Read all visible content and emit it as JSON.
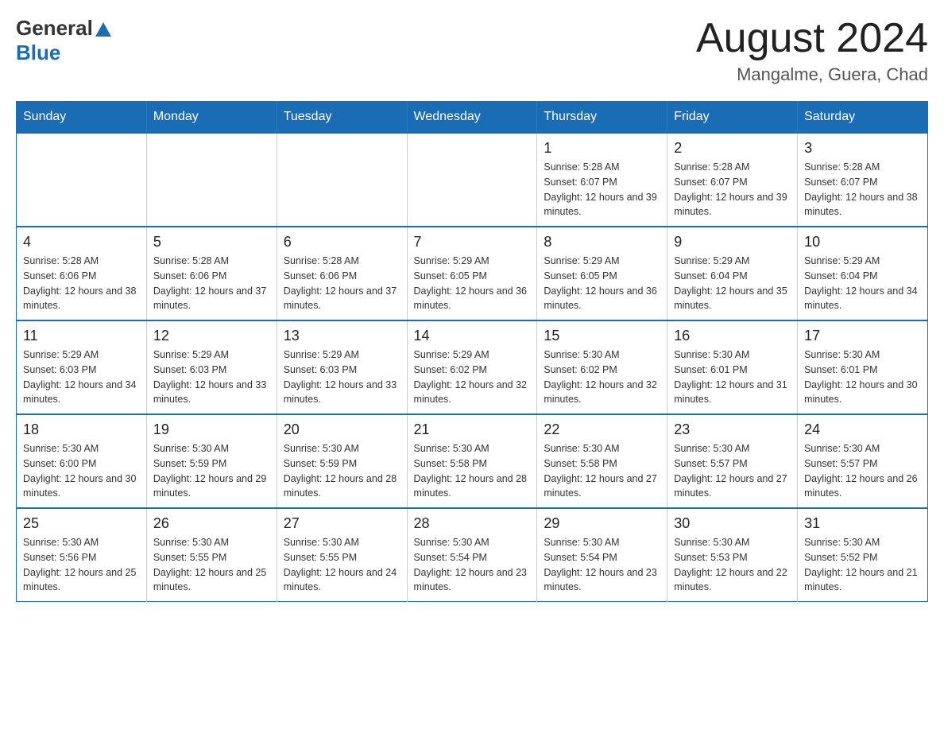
{
  "header": {
    "logo_general": "General",
    "logo_blue": "Blue",
    "month_title": "August 2024",
    "location": "Mangalme, Guera, Chad"
  },
  "weekdays": [
    "Sunday",
    "Monday",
    "Tuesday",
    "Wednesday",
    "Thursday",
    "Friday",
    "Saturday"
  ],
  "weeks": [
    [
      {
        "day": "",
        "sunrise": "",
        "sunset": "",
        "daylight": ""
      },
      {
        "day": "",
        "sunrise": "",
        "sunset": "",
        "daylight": ""
      },
      {
        "day": "",
        "sunrise": "",
        "sunset": "",
        "daylight": ""
      },
      {
        "day": "",
        "sunrise": "",
        "sunset": "",
        "daylight": ""
      },
      {
        "day": "1",
        "sunrise": "Sunrise: 5:28 AM",
        "sunset": "Sunset: 6:07 PM",
        "daylight": "Daylight: 12 hours and 39 minutes."
      },
      {
        "day": "2",
        "sunrise": "Sunrise: 5:28 AM",
        "sunset": "Sunset: 6:07 PM",
        "daylight": "Daylight: 12 hours and 39 minutes."
      },
      {
        "day": "3",
        "sunrise": "Sunrise: 5:28 AM",
        "sunset": "Sunset: 6:07 PM",
        "daylight": "Daylight: 12 hours and 38 minutes."
      }
    ],
    [
      {
        "day": "4",
        "sunrise": "Sunrise: 5:28 AM",
        "sunset": "Sunset: 6:06 PM",
        "daylight": "Daylight: 12 hours and 38 minutes."
      },
      {
        "day": "5",
        "sunrise": "Sunrise: 5:28 AM",
        "sunset": "Sunset: 6:06 PM",
        "daylight": "Daylight: 12 hours and 37 minutes."
      },
      {
        "day": "6",
        "sunrise": "Sunrise: 5:28 AM",
        "sunset": "Sunset: 6:06 PM",
        "daylight": "Daylight: 12 hours and 37 minutes."
      },
      {
        "day": "7",
        "sunrise": "Sunrise: 5:29 AM",
        "sunset": "Sunset: 6:05 PM",
        "daylight": "Daylight: 12 hours and 36 minutes."
      },
      {
        "day": "8",
        "sunrise": "Sunrise: 5:29 AM",
        "sunset": "Sunset: 6:05 PM",
        "daylight": "Daylight: 12 hours and 36 minutes."
      },
      {
        "day": "9",
        "sunrise": "Sunrise: 5:29 AM",
        "sunset": "Sunset: 6:04 PM",
        "daylight": "Daylight: 12 hours and 35 minutes."
      },
      {
        "day": "10",
        "sunrise": "Sunrise: 5:29 AM",
        "sunset": "Sunset: 6:04 PM",
        "daylight": "Daylight: 12 hours and 34 minutes."
      }
    ],
    [
      {
        "day": "11",
        "sunrise": "Sunrise: 5:29 AM",
        "sunset": "Sunset: 6:03 PM",
        "daylight": "Daylight: 12 hours and 34 minutes."
      },
      {
        "day": "12",
        "sunrise": "Sunrise: 5:29 AM",
        "sunset": "Sunset: 6:03 PM",
        "daylight": "Daylight: 12 hours and 33 minutes."
      },
      {
        "day": "13",
        "sunrise": "Sunrise: 5:29 AM",
        "sunset": "Sunset: 6:03 PM",
        "daylight": "Daylight: 12 hours and 33 minutes."
      },
      {
        "day": "14",
        "sunrise": "Sunrise: 5:29 AM",
        "sunset": "Sunset: 6:02 PM",
        "daylight": "Daylight: 12 hours and 32 minutes."
      },
      {
        "day": "15",
        "sunrise": "Sunrise: 5:30 AM",
        "sunset": "Sunset: 6:02 PM",
        "daylight": "Daylight: 12 hours and 32 minutes."
      },
      {
        "day": "16",
        "sunrise": "Sunrise: 5:30 AM",
        "sunset": "Sunset: 6:01 PM",
        "daylight": "Daylight: 12 hours and 31 minutes."
      },
      {
        "day": "17",
        "sunrise": "Sunrise: 5:30 AM",
        "sunset": "Sunset: 6:01 PM",
        "daylight": "Daylight: 12 hours and 30 minutes."
      }
    ],
    [
      {
        "day": "18",
        "sunrise": "Sunrise: 5:30 AM",
        "sunset": "Sunset: 6:00 PM",
        "daylight": "Daylight: 12 hours and 30 minutes."
      },
      {
        "day": "19",
        "sunrise": "Sunrise: 5:30 AM",
        "sunset": "Sunset: 5:59 PM",
        "daylight": "Daylight: 12 hours and 29 minutes."
      },
      {
        "day": "20",
        "sunrise": "Sunrise: 5:30 AM",
        "sunset": "Sunset: 5:59 PM",
        "daylight": "Daylight: 12 hours and 28 minutes."
      },
      {
        "day": "21",
        "sunrise": "Sunrise: 5:30 AM",
        "sunset": "Sunset: 5:58 PM",
        "daylight": "Daylight: 12 hours and 28 minutes."
      },
      {
        "day": "22",
        "sunrise": "Sunrise: 5:30 AM",
        "sunset": "Sunset: 5:58 PM",
        "daylight": "Daylight: 12 hours and 27 minutes."
      },
      {
        "day": "23",
        "sunrise": "Sunrise: 5:30 AM",
        "sunset": "Sunset: 5:57 PM",
        "daylight": "Daylight: 12 hours and 27 minutes."
      },
      {
        "day": "24",
        "sunrise": "Sunrise: 5:30 AM",
        "sunset": "Sunset: 5:57 PM",
        "daylight": "Daylight: 12 hours and 26 minutes."
      }
    ],
    [
      {
        "day": "25",
        "sunrise": "Sunrise: 5:30 AM",
        "sunset": "Sunset: 5:56 PM",
        "daylight": "Daylight: 12 hours and 25 minutes."
      },
      {
        "day": "26",
        "sunrise": "Sunrise: 5:30 AM",
        "sunset": "Sunset: 5:55 PM",
        "daylight": "Daylight: 12 hours and 25 minutes."
      },
      {
        "day": "27",
        "sunrise": "Sunrise: 5:30 AM",
        "sunset": "Sunset: 5:55 PM",
        "daylight": "Daylight: 12 hours and 24 minutes."
      },
      {
        "day": "28",
        "sunrise": "Sunrise: 5:30 AM",
        "sunset": "Sunset: 5:54 PM",
        "daylight": "Daylight: 12 hours and 23 minutes."
      },
      {
        "day": "29",
        "sunrise": "Sunrise: 5:30 AM",
        "sunset": "Sunset: 5:54 PM",
        "daylight": "Daylight: 12 hours and 23 minutes."
      },
      {
        "day": "30",
        "sunrise": "Sunrise: 5:30 AM",
        "sunset": "Sunset: 5:53 PM",
        "daylight": "Daylight: 12 hours and 22 minutes."
      },
      {
        "day": "31",
        "sunrise": "Sunrise: 5:30 AM",
        "sunset": "Sunset: 5:52 PM",
        "daylight": "Daylight: 12 hours and 21 minutes."
      }
    ]
  ]
}
